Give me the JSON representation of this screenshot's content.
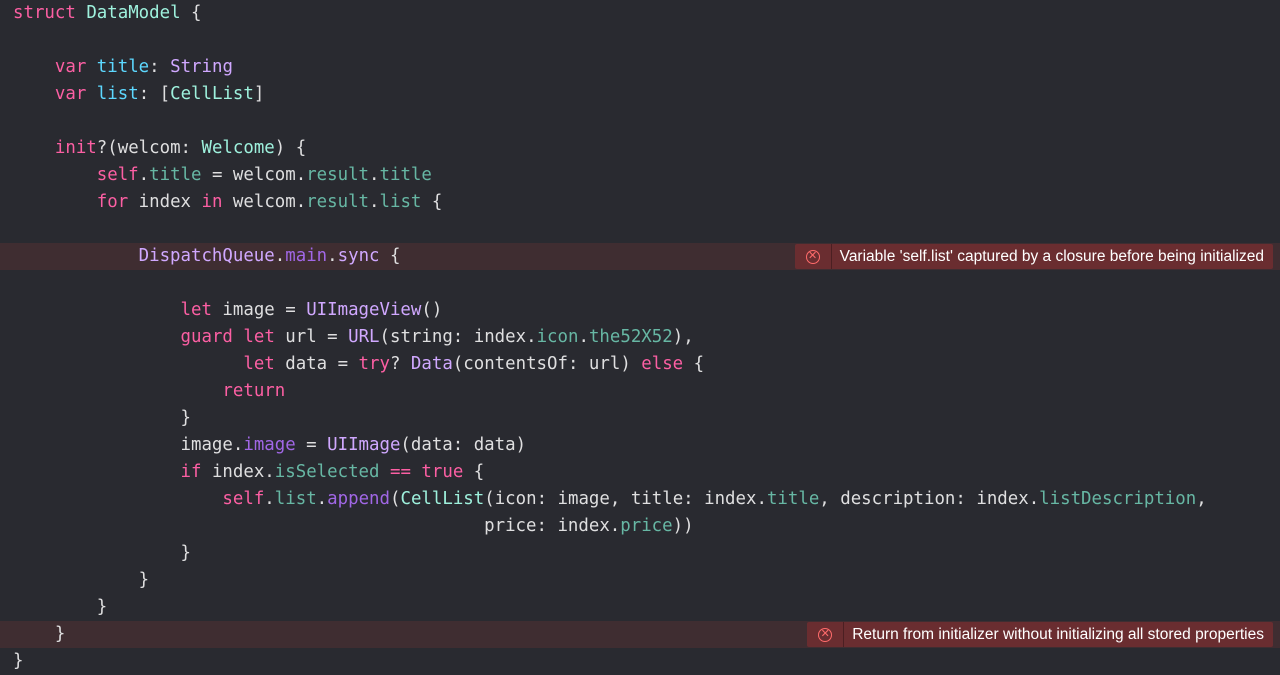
{
  "colors": {
    "background": "#292a30",
    "error_line": "#3f2d31",
    "error_banner": "#6a2d30",
    "keyword": "#fc5fa3",
    "type": "#d0a8ff",
    "class_name": "#9ef1dd",
    "property": "#67b7a4",
    "variable_decl": "#5dd8ff",
    "plain": "#dfdfe0"
  },
  "code": {
    "lines": [
      [
        [
          "kw",
          "struct"
        ],
        [
          "pl",
          " "
        ],
        [
          "cls",
          "DataModel"
        ],
        [
          "pl",
          " {"
        ]
      ],
      [],
      [
        [
          "pl",
          "    "
        ],
        [
          "kw",
          "var"
        ],
        [
          "pl",
          " "
        ],
        [
          "var",
          "title"
        ],
        [
          "pl",
          ": "
        ],
        [
          "typ",
          "String"
        ]
      ],
      [
        [
          "pl",
          "    "
        ],
        [
          "kw",
          "var"
        ],
        [
          "pl",
          " "
        ],
        [
          "var",
          "list"
        ],
        [
          "pl",
          ": ["
        ],
        [
          "cls",
          "CellList"
        ],
        [
          "pl",
          "]"
        ]
      ],
      [],
      [
        [
          "pl",
          "    "
        ],
        [
          "kw",
          "init"
        ],
        [
          "pl",
          "?(welcom: "
        ],
        [
          "cls",
          "Welcome"
        ],
        [
          "pl",
          ") {"
        ]
      ],
      [
        [
          "pl",
          "        "
        ],
        [
          "kw",
          "self"
        ],
        [
          "pl",
          "."
        ],
        [
          "prop",
          "title"
        ],
        [
          "pl",
          " = welcom."
        ],
        [
          "prop",
          "result"
        ],
        [
          "pl",
          "."
        ],
        [
          "prop",
          "title"
        ]
      ],
      [
        [
          "pl",
          "        "
        ],
        [
          "kw",
          "for"
        ],
        [
          "pl",
          " index "
        ],
        [
          "kw",
          "in"
        ],
        [
          "pl",
          " welcom."
        ],
        [
          "prop",
          "result"
        ],
        [
          "pl",
          "."
        ],
        [
          "prop",
          "list"
        ],
        [
          "pl",
          " {"
        ]
      ],
      [],
      [
        [
          "pl",
          "            "
        ],
        [
          "typ",
          "DispatchQueue"
        ],
        [
          "pl",
          "."
        ],
        [
          "pm",
          "main"
        ],
        [
          "pl",
          "."
        ],
        [
          "typ",
          "sync"
        ],
        [
          "pl",
          " {"
        ]
      ],
      [],
      [
        [
          "pl",
          "                "
        ],
        [
          "kw",
          "let"
        ],
        [
          "pl",
          " image = "
        ],
        [
          "typ",
          "UIImageView"
        ],
        [
          "pl",
          "()"
        ]
      ],
      [
        [
          "pl",
          "                "
        ],
        [
          "kw",
          "guard"
        ],
        [
          "pl",
          " "
        ],
        [
          "kw",
          "let"
        ],
        [
          "pl",
          " url = "
        ],
        [
          "typ",
          "URL"
        ],
        [
          "pl",
          "(string: index."
        ],
        [
          "prop",
          "icon"
        ],
        [
          "pl",
          "."
        ],
        [
          "prop",
          "the52X52"
        ],
        [
          "pl",
          "),"
        ]
      ],
      [
        [
          "pl",
          "                      "
        ],
        [
          "kw",
          "let"
        ],
        [
          "pl",
          " data = "
        ],
        [
          "kw",
          "try"
        ],
        [
          "pl",
          "? "
        ],
        [
          "typ",
          "Data"
        ],
        [
          "pl",
          "(contentsOf: url) "
        ],
        [
          "kw",
          "else"
        ],
        [
          "pl",
          " {"
        ]
      ],
      [
        [
          "pl",
          "                    "
        ],
        [
          "kw",
          "return"
        ]
      ],
      [
        [
          "pl",
          "                }"
        ]
      ],
      [
        [
          "pl",
          "                image."
        ],
        [
          "pm",
          "image"
        ],
        [
          "pl",
          " = "
        ],
        [
          "typ",
          "UIImage"
        ],
        [
          "pl",
          "(data: data)"
        ]
      ],
      [
        [
          "pl",
          "                "
        ],
        [
          "kw",
          "if"
        ],
        [
          "pl",
          " index."
        ],
        [
          "prop",
          "isSelected"
        ],
        [
          "pl",
          " "
        ],
        [
          "kw",
          "=="
        ],
        [
          "pl",
          " "
        ],
        [
          "kw",
          "true"
        ],
        [
          "pl",
          " {"
        ]
      ],
      [
        [
          "pl",
          "                    "
        ],
        [
          "kw",
          "self"
        ],
        [
          "pl",
          "."
        ],
        [
          "prop",
          "list"
        ],
        [
          "pl",
          "."
        ],
        [
          "pm",
          "append"
        ],
        [
          "pl",
          "("
        ],
        [
          "cls",
          "CellList"
        ],
        [
          "pl",
          "(icon: image, title: index."
        ],
        [
          "prop",
          "title"
        ],
        [
          "pl",
          ", description: index."
        ],
        [
          "prop",
          "listDescription"
        ],
        [
          "pl",
          ","
        ]
      ],
      [
        [
          "pl",
          "                                             price: index."
        ],
        [
          "prop",
          "price"
        ],
        [
          "pl",
          "))"
        ]
      ],
      [
        [
          "pl",
          "                }"
        ]
      ],
      [
        [
          "pl",
          "            }"
        ]
      ],
      [
        [
          "pl",
          "        }"
        ]
      ],
      [
        [
          "pl",
          "    }"
        ]
      ],
      [
        [
          "pl",
          "}"
        ]
      ]
    ]
  },
  "errors": [
    {
      "line": 9,
      "message": "Variable 'self.list' captured by a closure before being initialized"
    },
    {
      "line": 23,
      "message": "Return from initializer without initializing all stored properties"
    }
  ]
}
